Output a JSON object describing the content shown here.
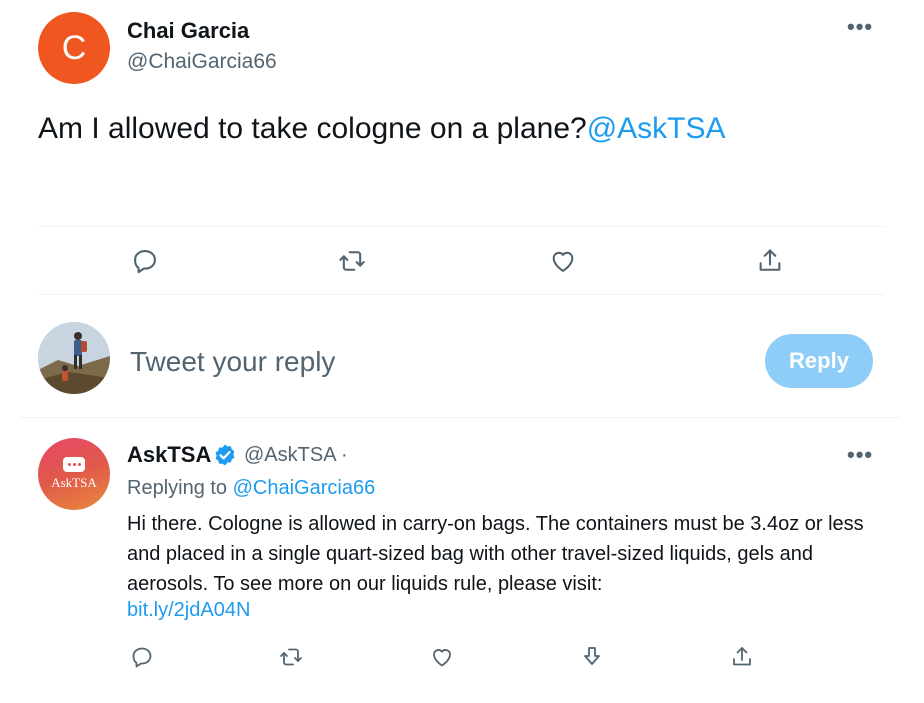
{
  "main_tweet": {
    "avatar_letter": "C",
    "author_name": "Chai Garcia",
    "author_handle": "@ChaiGarcia66",
    "text": "Am I allowed to take cologne on a plane?",
    "mention": "@AskTSA",
    "more_label": "•••"
  },
  "actions": [
    "reply-icon",
    "retweet-icon",
    "like-icon",
    "share-icon"
  ],
  "reply_box": {
    "placeholder": "Tweet your reply",
    "button_label": "Reply"
  },
  "reply_tweet": {
    "avatar_label": "AskTSA",
    "author_name": "AskTSA",
    "author_handle": "@AskTSA ·",
    "replying_prefix": "Replying to",
    "replying_to": "@ChaiGarcia66",
    "text": "Hi there. Cologne is allowed in carry-on bags. The containers must be 3.4oz or less and placed in a single quart-sized bag with other travel-sized liquids, gels and aerosols. To see more on our liquids rule, please visit:",
    "link": "bit.ly/2jdA04N",
    "more_label": "•••"
  },
  "colors": {
    "accent": "#1d9bf0",
    "avatar_c": "#f0561f",
    "reply_button": "#8ecdf8",
    "secondary_text": "#536471"
  }
}
